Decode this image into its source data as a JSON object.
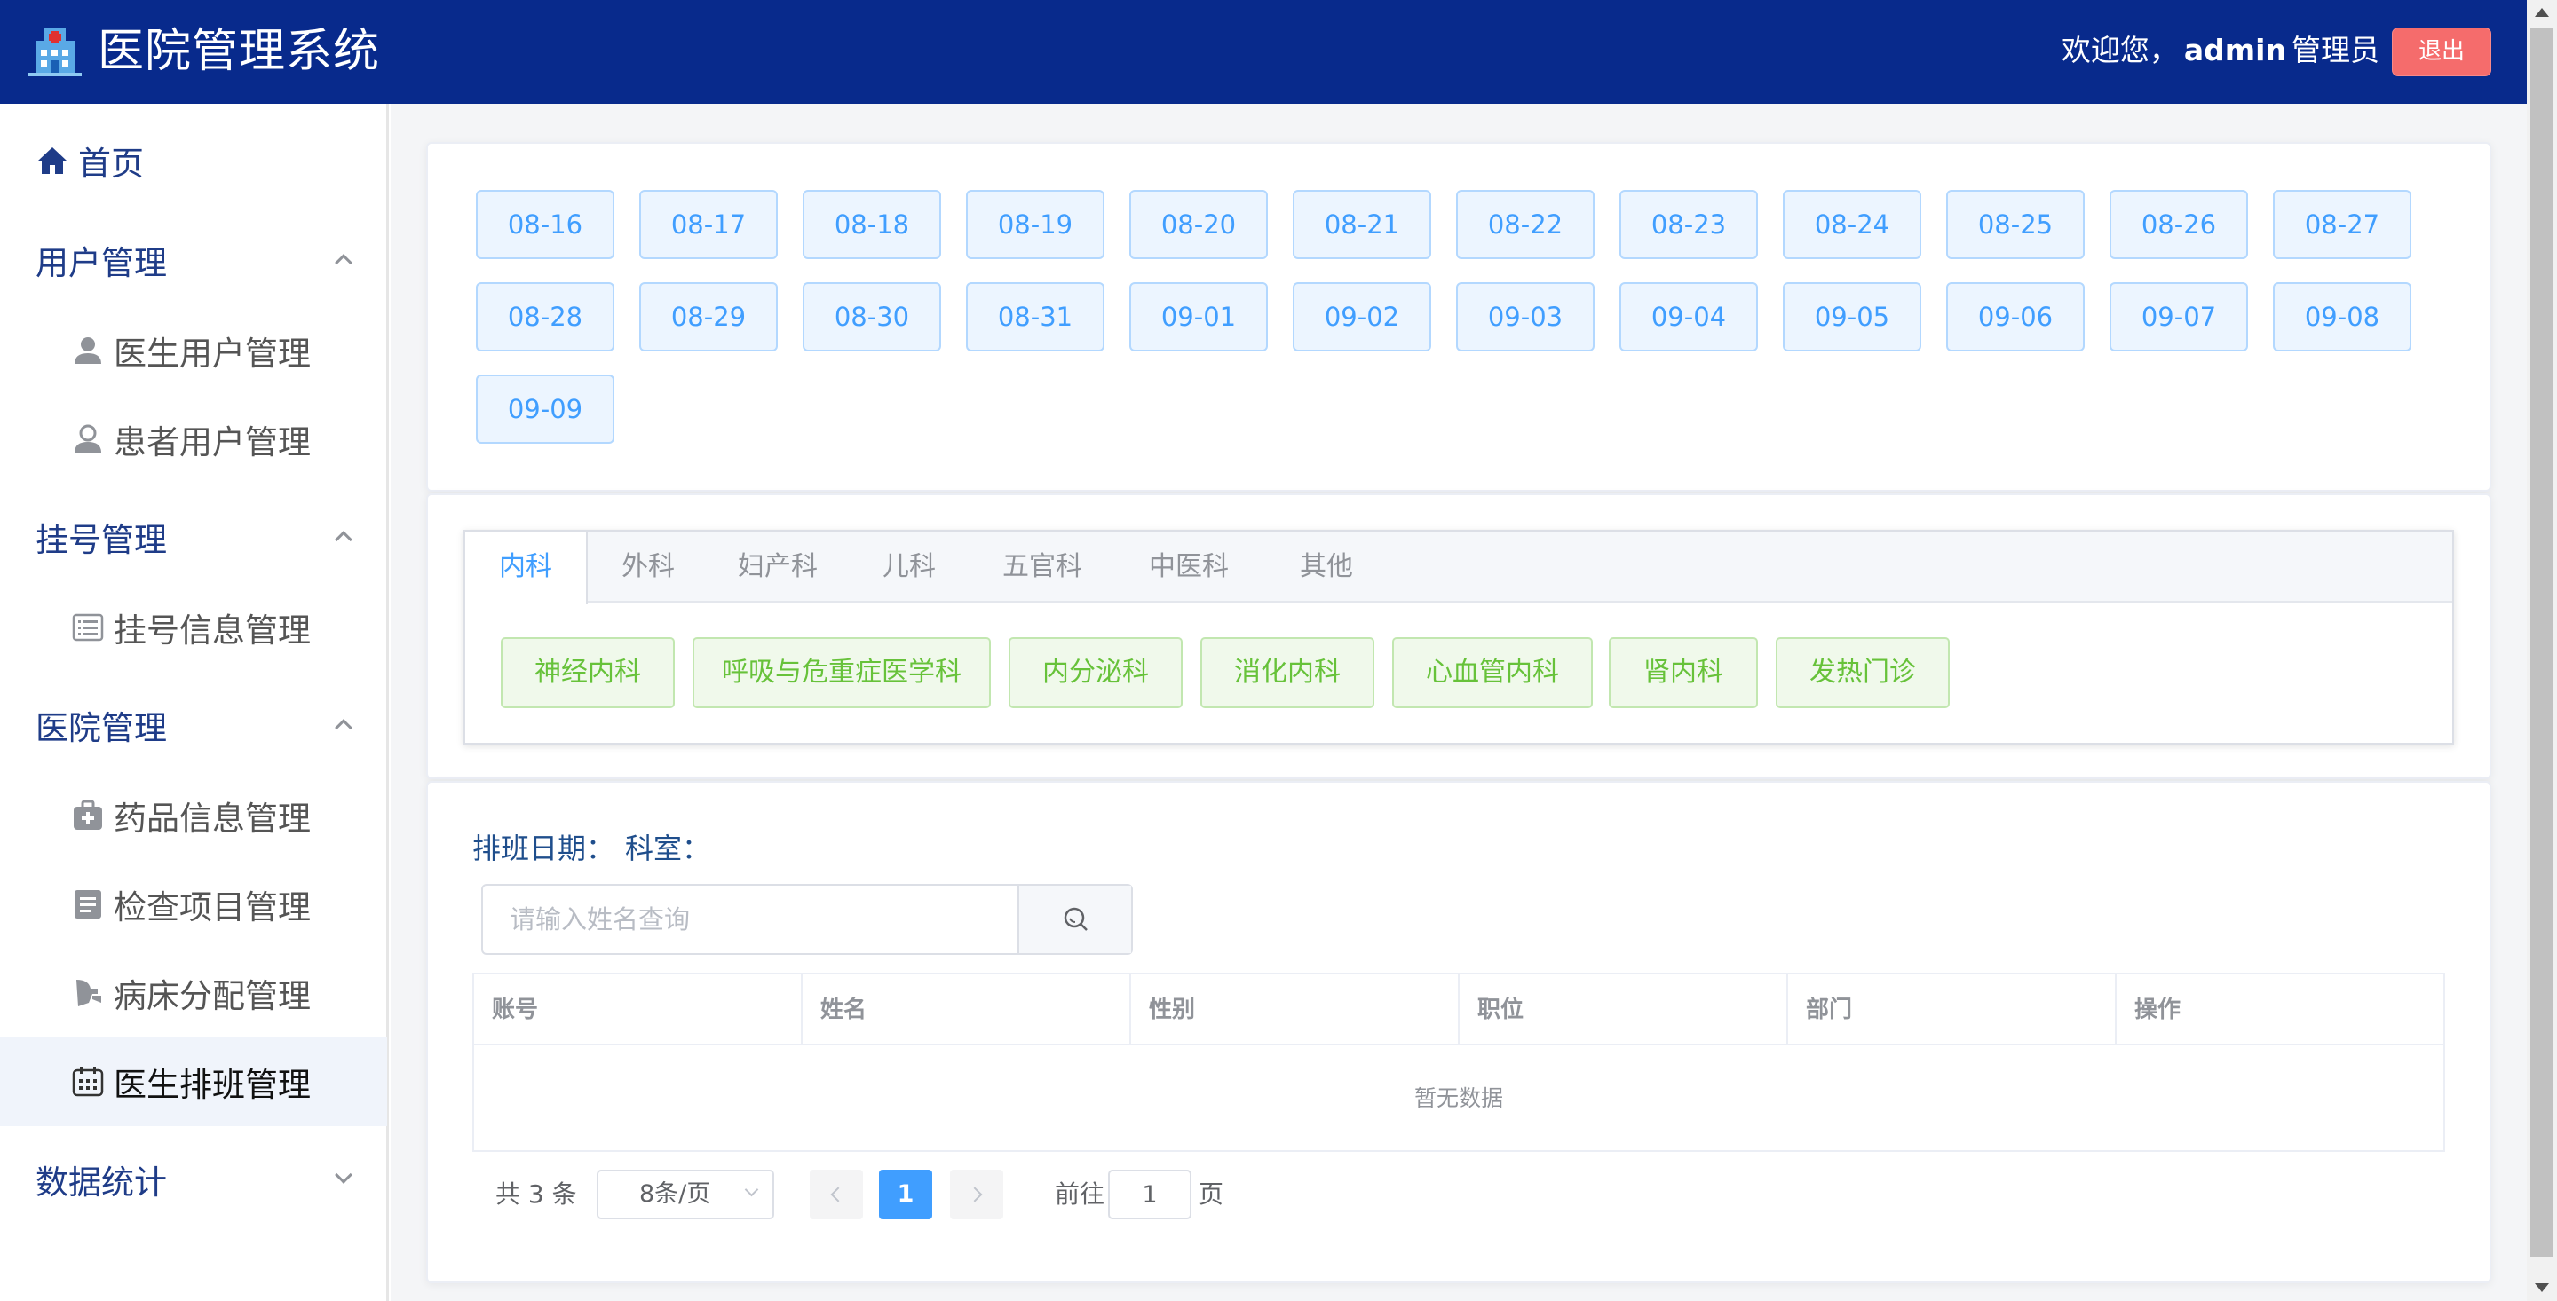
{
  "header": {
    "title": "医院管理系统",
    "welcome_prefix": "欢迎您，",
    "username": "admin",
    "role": "管理员",
    "logout_label": "退出"
  },
  "sidebar": {
    "home": "首页",
    "user_mgmt": "用户管理",
    "doctor_users": "医生用户管理",
    "patient_users": "患者用户管理",
    "register_mgmt": "挂号管理",
    "register_info": "挂号信息管理",
    "hospital_mgmt": "医院管理",
    "drug_info": "药品信息管理",
    "exam_items": "检查项目管理",
    "bed_assign": "病床分配管理",
    "doctor_schedule": "医生排班管理",
    "statistics": "数据统计"
  },
  "dates": [
    "08-16",
    "08-17",
    "08-18",
    "08-19",
    "08-20",
    "08-21",
    "08-22",
    "08-23",
    "08-24",
    "08-25",
    "08-26",
    "08-27",
    "08-28",
    "08-29",
    "08-30",
    "08-31",
    "09-01",
    "09-02",
    "09-03",
    "09-04",
    "09-05",
    "09-06",
    "09-07",
    "09-08",
    "09-09"
  ],
  "tabs": [
    "内科",
    "外科",
    "妇产科",
    "儿科",
    "五官科",
    "中医科",
    "其他"
  ],
  "departments": [
    "神经内科",
    "呼吸与危重症医学科",
    "内分泌科",
    "消化内科",
    "心血管内科",
    "肾内科",
    "发热门诊"
  ],
  "schedule": {
    "date_label": "排班日期：",
    "dept_label": "科室：",
    "search_placeholder": "请输入姓名查询"
  },
  "table": {
    "columns": [
      "账号",
      "姓名",
      "性别",
      "职位",
      "部门",
      "操作"
    ],
    "empty_text": "暂无数据"
  },
  "pagination": {
    "total": "共 3 条",
    "page_size": "8条/页",
    "current_page": "1",
    "goto_prefix": "前往",
    "goto_value": "1",
    "goto_suffix": "页"
  },
  "colors": {
    "header_bg": "#082a8c",
    "logout_bg": "#f56c6c",
    "primary": "#409eff",
    "success": "#67c23a"
  }
}
